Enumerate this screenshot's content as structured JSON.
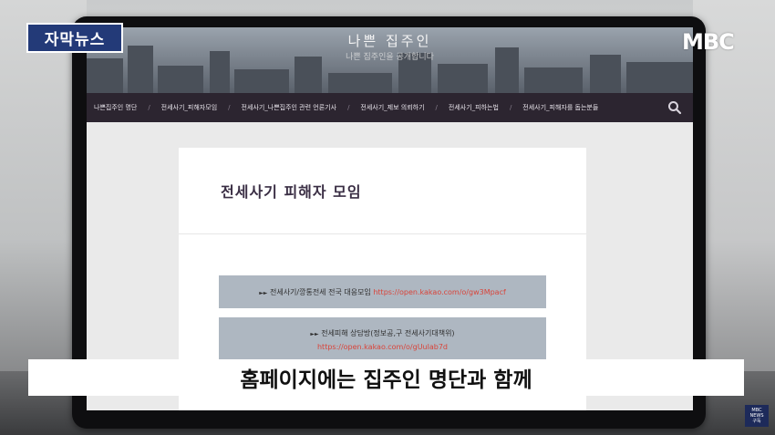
{
  "overlay": {
    "channel_badge": "자막뉴스",
    "network_logo": "MBC",
    "caption": "홈페이지에는 집주인 명단과 함께",
    "corner_badge_top": "MBC",
    "corner_badge_mid": "NEWS",
    "corner_badge_bottom": "구독"
  },
  "site": {
    "title": "나쁜 집주인",
    "tagline": "나쁜 집주인을 공개합니다",
    "nav": [
      "나쁜집주인 명단",
      "전세사기_피해자모임",
      "전세사기_나쁜집주인 관련 언론기사",
      "전세사기_제보 의뢰하기",
      "전세사기_피하는법",
      "전세사기_피해자를 돕는분들"
    ],
    "search_icon": "search-icon"
  },
  "post": {
    "title": "전세사기 피해자 모임",
    "box1_text": "전세사기/깡통전세 전국 대응모임",
    "box1_link": "https://open.kakao.com/o/gw3Mpacf",
    "box2_text": "전세피해 상담방(정보공,구 전세사기대책위)",
    "box2_link": "https://open.kakao.com/o/gUulab7d"
  },
  "colors": {
    "nav_bg": "#2c2530",
    "badge_bg": "#233a78",
    "link": "#d9443a",
    "box_bg": "#aeb7c1"
  }
}
